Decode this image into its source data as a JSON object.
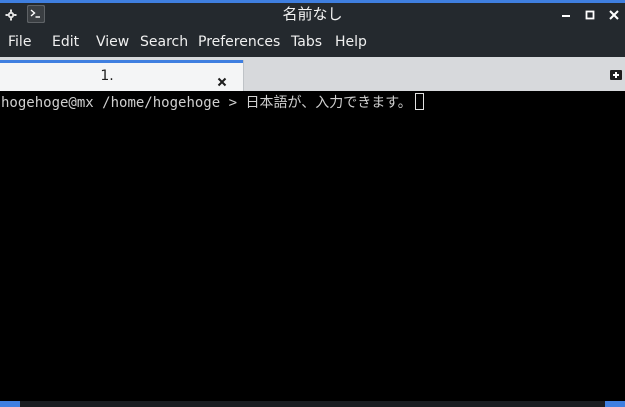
{
  "window": {
    "title": "名前なし",
    "accent_color": "#3f7fe0"
  },
  "titlebar": {
    "menu_icon": "gear-icon",
    "app_icon": "terminal-icon",
    "controls": [
      "minimize-icon",
      "maximize-icon",
      "close-icon"
    ]
  },
  "menubar": {
    "items": [
      "File",
      "Edit",
      "View",
      "Search",
      "Preferences",
      "Tabs",
      "Help"
    ]
  },
  "tabs": [
    {
      "label": "1.",
      "active": true
    }
  ],
  "tab_actions": {
    "new_tab_icon": "new-tab-icon"
  },
  "terminal": {
    "prompt_user_host": "hogehoge@mx",
    "prompt_path": "/home/hogehoge",
    "prompt_symbol": ">",
    "input_text": "日本語が、入力できます。",
    "text_color": "#d0d0d0",
    "background_color": "#000000"
  }
}
